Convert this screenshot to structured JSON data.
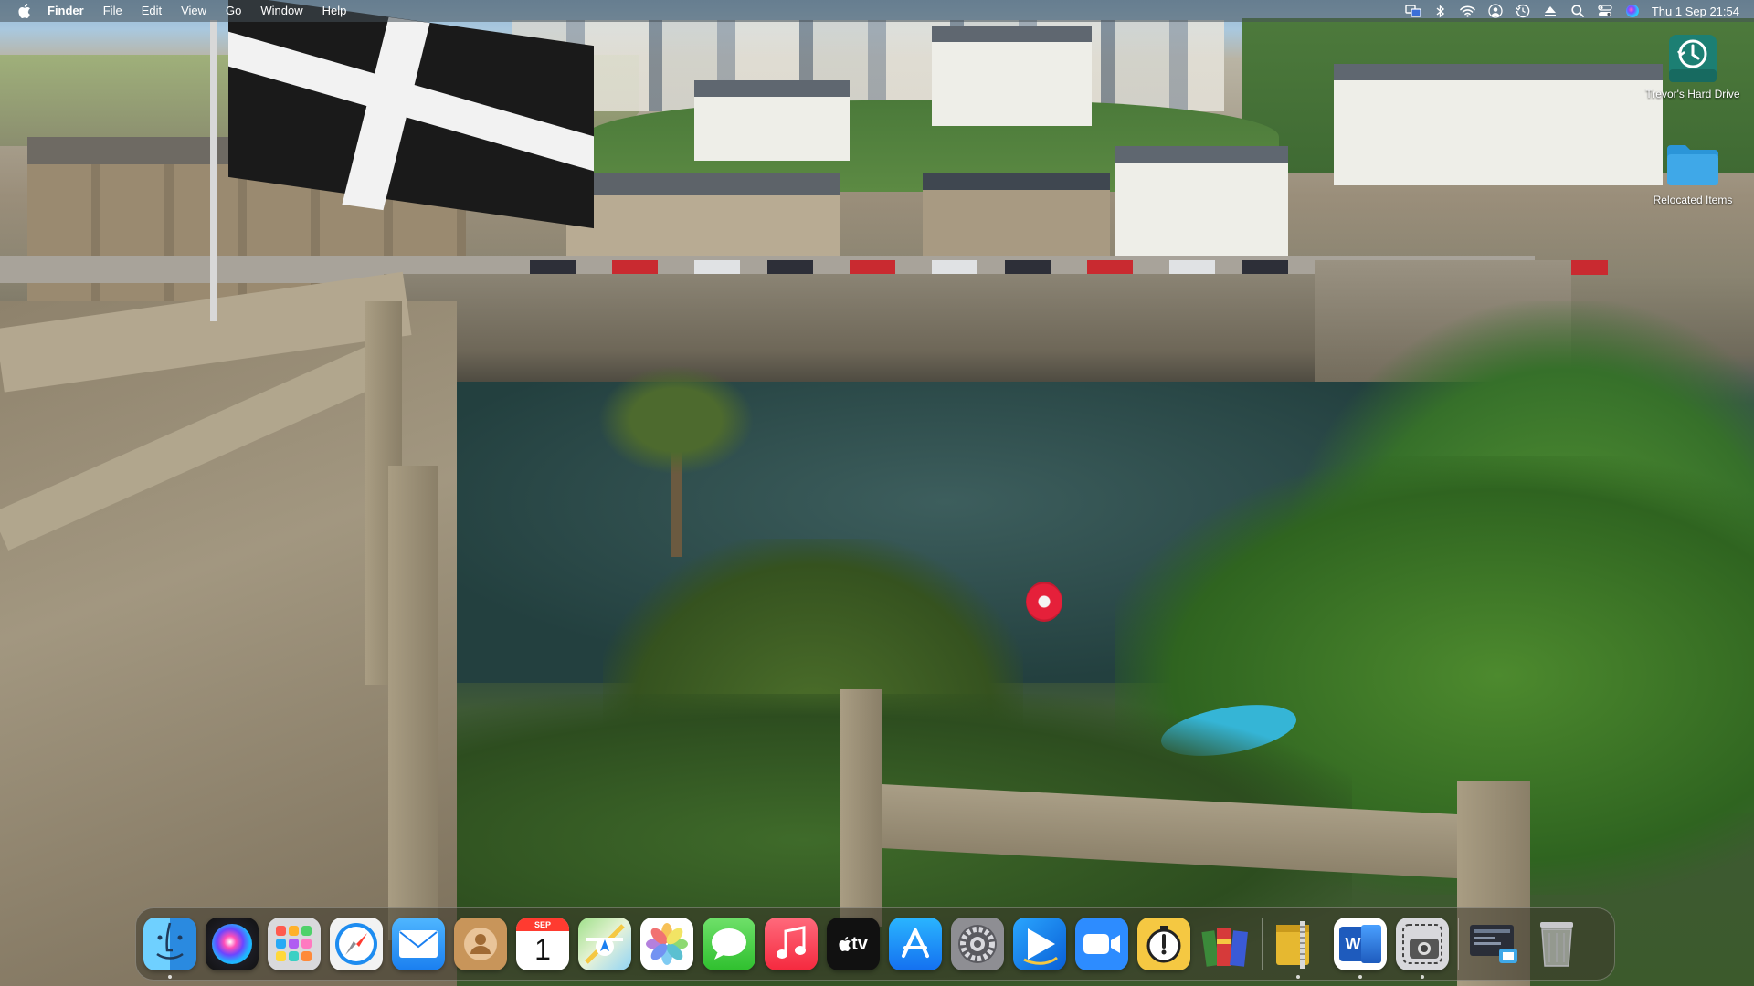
{
  "menubar": {
    "apple_icon": "apple-logo",
    "app_name": "Finder",
    "menus": [
      "File",
      "Edit",
      "View",
      "Go",
      "Window",
      "Help"
    ],
    "status_icons": [
      "screen-mirroring-icon",
      "bluetooth-icon",
      "wifi-icon",
      "user-account-icon",
      "time-machine-icon",
      "eject-icon",
      "spotlight-search-icon",
      "control-center-icon",
      "siri-icon"
    ],
    "clock": "Thu 1 Sep  21:54"
  },
  "desktop": {
    "icons": [
      {
        "label": "Trevor's Hard Drive",
        "icon": "time-machine-drive-icon"
      },
      {
        "label": "Relocated Items",
        "icon": "folder-icon"
      }
    ]
  },
  "dock": {
    "apps": [
      {
        "name": "Finder",
        "icon": "finder-icon",
        "running": true
      },
      {
        "name": "Siri",
        "icon": "siri-icon",
        "running": false
      },
      {
        "name": "Launchpad",
        "icon": "launchpad-icon",
        "running": false
      },
      {
        "name": "Safari",
        "icon": "safari-icon",
        "running": false
      },
      {
        "name": "Mail",
        "icon": "mail-icon",
        "running": false
      },
      {
        "name": "Contacts",
        "icon": "contacts-icon",
        "running": false
      },
      {
        "name": "Calendar",
        "icon": "calendar-icon",
        "month": "SEP",
        "day": "1",
        "running": false
      },
      {
        "name": "Maps",
        "icon": "maps-icon",
        "running": false
      },
      {
        "name": "Photos",
        "icon": "photos-icon",
        "running": false
      },
      {
        "name": "Messages",
        "icon": "messages-icon",
        "running": false
      },
      {
        "name": "Music",
        "icon": "music-icon",
        "running": false
      },
      {
        "name": "TV",
        "icon": "apple-tv-icon",
        "text": "tv",
        "running": false
      },
      {
        "name": "App Store",
        "icon": "app-store-icon",
        "running": false
      },
      {
        "name": "System Preferences",
        "icon": "system-preferences-icon",
        "running": false
      },
      {
        "name": "Prime Video",
        "icon": "prime-video-icon",
        "running": false
      },
      {
        "name": "Zoom",
        "icon": "zoom-icon",
        "running": false
      },
      {
        "name": "Instastats",
        "icon": "stopwatch-icon",
        "running": false
      },
      {
        "name": "RAR Extractor",
        "icon": "archive-books-icon",
        "running": false
      }
    ],
    "others": [
      {
        "name": "Archive Utility",
        "icon": "zipper-archive-icon",
        "running": true
      },
      {
        "name": "Microsoft Word",
        "icon": "word-icon",
        "text": "W",
        "running": true
      },
      {
        "name": "Screenshot",
        "icon": "screenshot-icon",
        "running": true
      },
      {
        "name": "Downloads",
        "icon": "downloads-stack-icon",
        "running": false
      },
      {
        "name": "Trash",
        "icon": "trash-icon",
        "running": false
      }
    ]
  },
  "colors": {
    "menubar_bg": "#46505880",
    "dock_bg": "#3c382c8c",
    "folder_blue": "#3fa8e8",
    "time_machine_teal": "#1c7f73"
  }
}
